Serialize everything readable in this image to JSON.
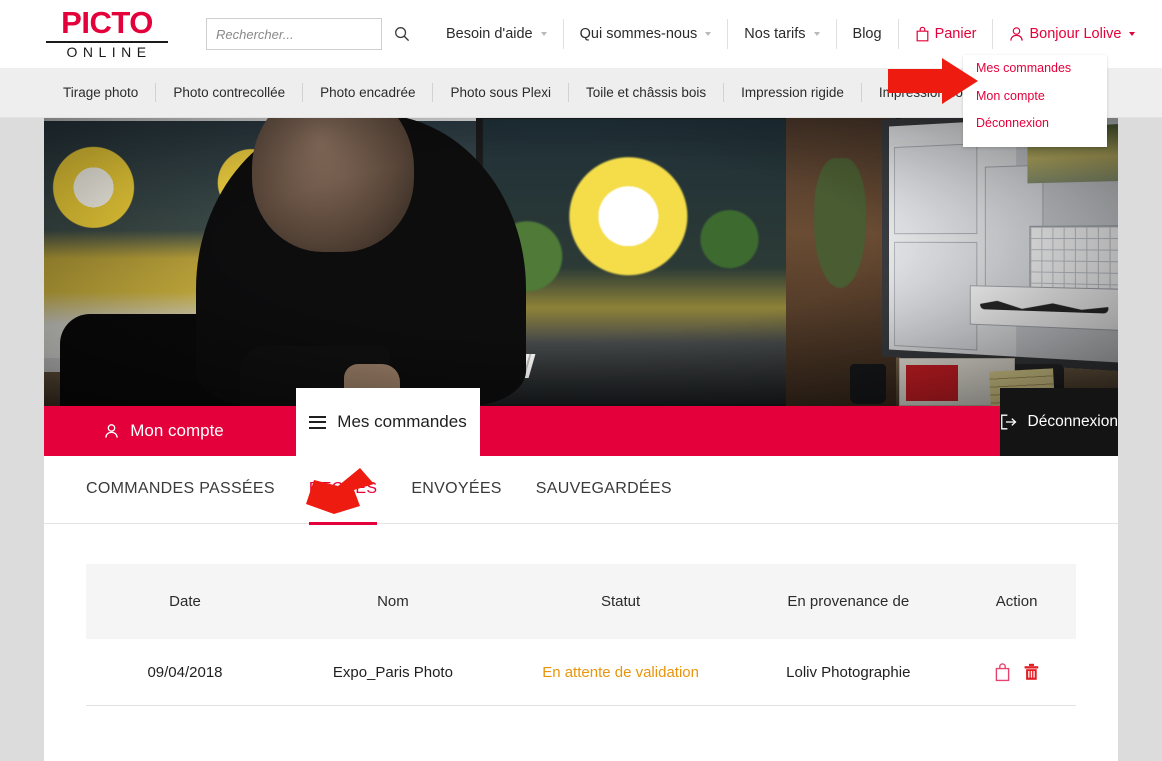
{
  "brand": {
    "logo_top": "PICTO",
    "logo_bottom": "ONLINE",
    "red": "#e4003a",
    "status_orange": "#e8950c"
  },
  "search": {
    "placeholder": "Rechercher...",
    "value": "",
    "icon": "search-icon"
  },
  "topnav": {
    "items": [
      {
        "label": "Besoin d'aide",
        "caret": true,
        "red": false
      },
      {
        "label": "Qui sommes-nous",
        "caret": true,
        "red": false
      },
      {
        "label": "Nos tarifs",
        "caret": true,
        "red": false
      },
      {
        "label": "Blog",
        "caret": false,
        "red": false
      },
      {
        "label": "Panier",
        "caret": false,
        "red": true,
        "icon": "shopping-bag-icon"
      },
      {
        "label": "Bonjour Lolive",
        "caret": true,
        "red": true,
        "icon": "user-icon"
      }
    ]
  },
  "account_dropdown": {
    "open": true,
    "items": [
      {
        "label": "Mes commandes"
      },
      {
        "label": "Mon compte"
      },
      {
        "label": "Déconnexion"
      }
    ]
  },
  "categories": {
    "items": [
      {
        "label": "Tirage photo"
      },
      {
        "label": "Photo contrecollée"
      },
      {
        "label": "Photo encadrée"
      },
      {
        "label": "Photo sous Plexi"
      },
      {
        "label": "Toile et châssis bois"
      },
      {
        "label": "Impression rigide"
      },
      {
        "label": "Impression souple"
      }
    ]
  },
  "account_tabs": {
    "mon_compte": "Mon compte",
    "mes_commandes": "Mes commandes",
    "deconnexion": "Déconnexion"
  },
  "order_tabs": {
    "items": [
      {
        "label": "COMMANDES PASSÉES",
        "active": false
      },
      {
        "label": "REÇUES",
        "active": true
      },
      {
        "label": "ENVOYÉES",
        "active": false
      },
      {
        "label": "SAUVEGARDÉES",
        "active": false
      }
    ]
  },
  "orders_table": {
    "columns": [
      "Date",
      "Nom",
      "Statut",
      "En provenance de",
      "Action"
    ],
    "rows": [
      {
        "date": "09/04/2018",
        "nom": "Expo_Paris Photo",
        "statut": "En attente de validation",
        "provenance": "Loliv Photographie",
        "actions": [
          "cart-icon",
          "trash-icon"
        ]
      }
    ]
  },
  "annotations": [
    {
      "name": "arrow-to-mes-commandes",
      "direction": "right",
      "color": "#ee1b11"
    },
    {
      "name": "arrow-to-recues-tab",
      "direction": "down-left",
      "color": "#ee1b11"
    }
  ]
}
